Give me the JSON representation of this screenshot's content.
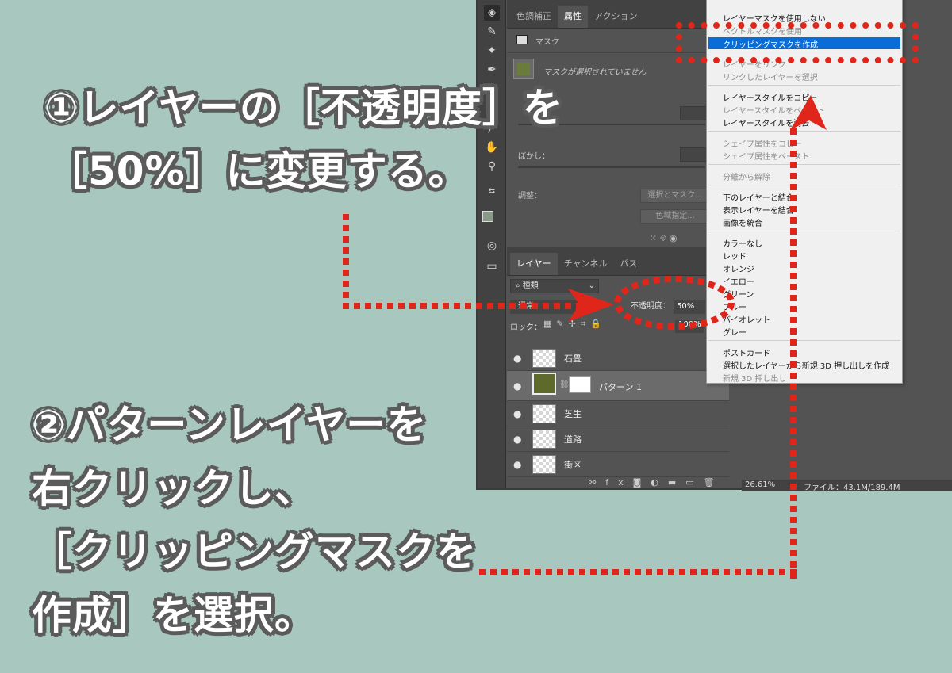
{
  "instructions": {
    "step1_line1": "①レイヤーの［不透明度］を",
    "step1_line2": "［50%］に変更する。",
    "step2_line1": "②パターンレイヤーを",
    "step2_line2": "右クリックし、",
    "step2_line3": "［クリッピングマスクを",
    "step2_line4": "作成］を選択。"
  },
  "properties_panel": {
    "tabs": [
      "色調補正",
      "属性",
      "アクション"
    ],
    "active_tab": "属性",
    "mask_label": "マスク",
    "no_mask_selected": "マスクが選択されていません",
    "blur_label": "ぼかし：",
    "adjust_label": "調整：",
    "select_mask_button": "選択とマスク...",
    "color_range_button": "色域指定..."
  },
  "layers_panel": {
    "tabs": [
      "レイヤー",
      "チャンネル",
      "パス"
    ],
    "filter_kind": "種類",
    "blend_mode": "通常",
    "opacity_label": "不透明度：",
    "opacity_value": "50%",
    "lock_label": "ロック：",
    "fill_value": "100%",
    "layers": [
      {
        "name": "石畳",
        "selected": false,
        "type": "raster"
      },
      {
        "name": "パターン 1",
        "selected": true,
        "type": "pattern"
      },
      {
        "name": "芝生",
        "selected": false,
        "type": "raster"
      },
      {
        "name": "道路",
        "selected": false,
        "type": "raster"
      },
      {
        "name": "街区",
        "selected": false,
        "type": "raster"
      }
    ]
  },
  "context_menu": {
    "items": [
      {
        "label": "レイヤーマスクを使用しない",
        "disabled": false
      },
      {
        "label": "ベクトルマスクを使用",
        "disabled": true
      },
      {
        "label": "クリッピングマスクを作成",
        "disabled": false,
        "highlighted": true
      },
      {
        "label": "レイヤーをリンク",
        "disabled": true
      },
      {
        "label": "リンクしたレイヤーを選択",
        "disabled": true
      },
      {
        "label": "レイヤースタイルをコピー",
        "disabled": false
      },
      {
        "label": "レイヤースタイルをペースト",
        "disabled": true
      },
      {
        "label": "レイヤースタイルを消去",
        "disabled": false
      },
      {
        "label": "シェイプ属性をコピー",
        "disabled": true
      },
      {
        "label": "シェイプ属性をペースト",
        "disabled": true
      },
      {
        "label": "分離から解除",
        "disabled": true
      },
      {
        "label": "下のレイヤーと結合",
        "disabled": false
      },
      {
        "label": "表示レイヤーを結合",
        "disabled": false
      },
      {
        "label": "画像を統合",
        "disabled": false
      },
      {
        "label": "カラーなし",
        "disabled": false
      },
      {
        "label": "レッド",
        "disabled": false
      },
      {
        "label": "オレンジ",
        "disabled": false
      },
      {
        "label": "イエロー",
        "disabled": false
      },
      {
        "label": "グリーン",
        "disabled": false
      },
      {
        "label": "ブルー",
        "disabled": false
      },
      {
        "label": "バイオレット",
        "disabled": false
      },
      {
        "label": "グレー",
        "disabled": false
      },
      {
        "label": "ポストカード",
        "disabled": false
      },
      {
        "label": "選択したレイヤーから新規 3D 押し出しを作成",
        "disabled": false
      },
      {
        "label": "新規 3D 押し出し",
        "disabled": true
      }
    ]
  },
  "status_bar": {
    "zoom": "26.61%",
    "file_info": "ファイル：43.1M/189.4M"
  },
  "colors": {
    "background": "#a8c8bf",
    "accent_red": "#e0261b",
    "menu_highlight": "#0a6cd6",
    "text_outline": "#5b5b5b"
  }
}
